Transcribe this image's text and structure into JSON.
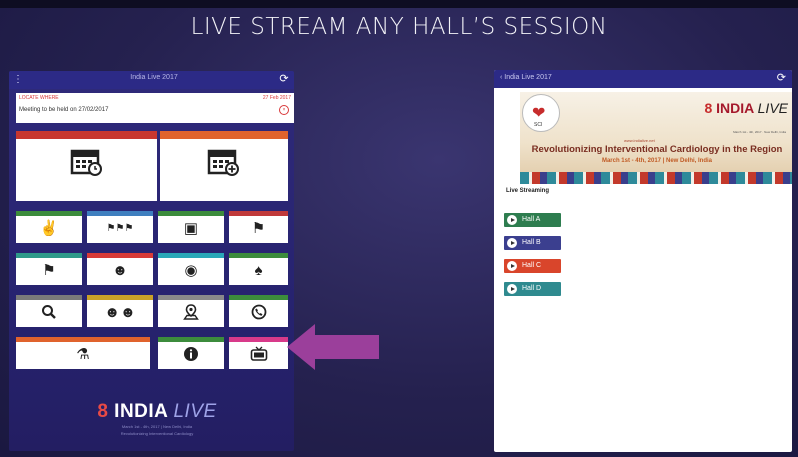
{
  "slide": {
    "title": "LIVE STREAM ANY HALL’S SESSION"
  },
  "left_app": {
    "menu_icon": "hamburger-icon",
    "header_title": "India Live 2017",
    "refresh_icon": "refresh-icon",
    "notice": {
      "header": "LOCATE WHERE",
      "date": "27 Feb 2017",
      "message": "Meeting to be held on 27/02/2017"
    },
    "big_tiles": [
      {
        "icon": "calendar-clock-icon",
        "glyph": "📅",
        "color": "#c8372f"
      },
      {
        "icon": "calendar-add-icon",
        "glyph": "📅",
        "color": "#e0632d"
      }
    ],
    "tiles": [
      {
        "icon": "handshake-icon",
        "glyph": "🤝",
        "color": "#3c8c3c"
      },
      {
        "icon": "group-icon",
        "glyph": "☃",
        "color": "#3f7fbf"
      },
      {
        "icon": "stop-icon",
        "glyph": "▣",
        "color": "#3c8c3c"
      },
      {
        "icon": "presenter-icon",
        "glyph": "⚑",
        "color": "#c0393a"
      },
      {
        "icon": "presenter-board-icon",
        "glyph": "⚑",
        "color": "#2f9a8a"
      },
      {
        "icon": "user-speaker-icon",
        "glyph": "☺",
        "color": "#d83a37"
      },
      {
        "icon": "location-person-icon",
        "glyph": "●",
        "color": "#2aa8b8"
      },
      {
        "icon": "people-group-icon",
        "glyph": "♠",
        "color": "#3c8c3c"
      },
      {
        "icon": "search-icon",
        "glyph": "⌕",
        "color": "#7a7a7a"
      },
      {
        "icon": "users-icon",
        "glyph": "☻",
        "color": "#2aa8b8"
      },
      {
        "icon": "map-pin-icon",
        "glyph": "⌖",
        "color": "#8a8a8a"
      },
      {
        "icon": "phone-icon",
        "glyph": "☎",
        "color": "#3c8c3c"
      },
      {
        "icon": "info-icon",
        "glyph": "ⓘ",
        "color": "#3c8c3c"
      },
      {
        "icon": "tv-icon",
        "glyph": "📺",
        "color": "#d83a8a"
      }
    ],
    "wide_tile": {
      "icon": "microscope-icon",
      "glyph": "⚗",
      "color": "#e0632d"
    },
    "logo": {
      "prefix": "8",
      "name": "INDIA",
      "suffix": "LIVE",
      "line1": "March 1st - 4th, 2017 | New Delhi, India",
      "line2": "Revolutionizing Interventional Cardiology"
    }
  },
  "right_app": {
    "back_label": "‹ India Live 2017",
    "refresh_icon": "refresh-icon",
    "banner": {
      "badge_text": "SCI",
      "logo_prefix": "8",
      "logo_name": "INDIA",
      "logo_suffix": "LIVE",
      "sub": "March 1st - 4th, 2017 · New Delhi, India",
      "site": "www.indialive.net",
      "headline": "Revolutionizing Interventional Cardiology in the Region",
      "dates": "March 1st - 4th, 2017 | New Delhi, India"
    },
    "section_label": "Live Streaming",
    "halls": [
      {
        "label": "Hall A",
        "color": "#2e7d4f"
      },
      {
        "label": "Hall B",
        "color": "#3b3f8f"
      },
      {
        "label": "Hall C",
        "color": "#d9452b"
      },
      {
        "label": "Hall D",
        "color": "#2f8a8f"
      }
    ]
  },
  "arrow_color": "#9b3f9b"
}
